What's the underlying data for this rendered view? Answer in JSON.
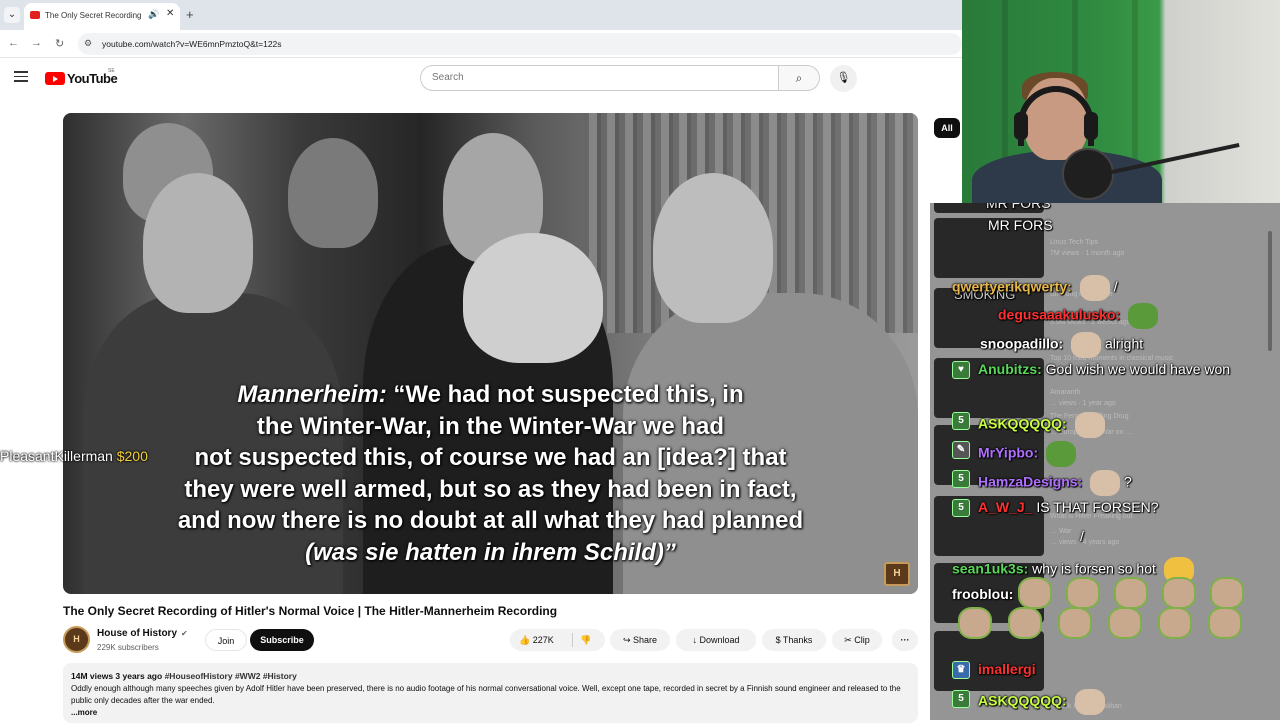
{
  "browser": {
    "tab_title": "The Only Secret Recording",
    "url": "youtube.com/watch?v=WE6mnPmztoQ&t=122s"
  },
  "youtube": {
    "logo_text": "YouTube",
    "country_code": "SE",
    "search_placeholder": "Search"
  },
  "video": {
    "subtitle_speaker": "Mannerheim:",
    "subtitle_lines": [
      "“We had not suspected this, in",
      "the Winter-War, in the Winter-War we had",
      "not suspected this, of course we had an [idea?] that",
      "they were well armed, but so as they had been in fact,",
      "and now there is no doubt at all what they had planned"
    ],
    "subtitle_german": "(was sie hatten in ihrem Schild)”",
    "watermark": "H",
    "donation_user": "PleasantKillerman",
    "donation_amount": "$200",
    "title": "The Only Secret Recording of Hitler's Normal Voice | The Hitler-Mannerheim Recording"
  },
  "channel": {
    "avatar_text": "H",
    "name": "House of History",
    "subscribers": "229K subscribers",
    "join_label": "Join",
    "subscribe_label": "Subscribe"
  },
  "actions": {
    "likes": "227K",
    "share_label": "Share",
    "download_label": "Download",
    "thanks_label": "Thanks",
    "clip_label": "Clip",
    "more_label": "···"
  },
  "description": {
    "meta": "14M views  3 years ago",
    "tags": "#HouseofHistory #WW2 #History",
    "text": "Oddly enough although many speeches given by Adolf Hitler have been preserved, there is no audio footage of his normal conversational voice. Well, except one tape, recorded in secret by a Finnish sound engineer and released to the public only decades after the war ended.",
    "more": "...more"
  },
  "sidebar": {
    "chip_all": "All",
    "thumb_texts": [
      "Linus Tech Tips",
      "7M views · 1 month ago",
      "Smoking is … home",
      "5.9M views · 2 weeks ago",
      "Top 10 mob moments in classical music",
      "Amaranth",
      "… views · 1 year ago",
      "The Fentanyl Killing Drug",
      "… Europe | The War on …",
      "What is Hitler Freaking out",
      "… War",
      "… views · 4 years ago",
      "A Look Inside a Taliban"
    ]
  },
  "chat": {
    "messages": [
      {
        "user": "",
        "text": "MR FORS",
        "color": "#ffffff"
      },
      {
        "user": "qwertyerikqwerty:",
        "text": "/",
        "color": "#e8b84a"
      },
      {
        "user": "degusaaakulusko:",
        "text": "",
        "color": "#ff3030"
      },
      {
        "user": "snoopadillo:",
        "text": "alright",
        "color": "#ffffff"
      },
      {
        "user": "Anubitzs:",
        "text": "God wish we would have won",
        "color": "#5ad85a"
      },
      {
        "user": "ASKQQQQQ:",
        "text": "",
        "color": "#c8ff40"
      },
      {
        "user": "MrYipbo:",
        "text": "",
        "color": "#b070ff"
      },
      {
        "user": "HamzaDesigns:",
        "text": "?",
        "color": "#b070ff"
      },
      {
        "user": "A_W_J_",
        "text": "IS THAT FORSEN?",
        "color": "#ff3030"
      },
      {
        "user": "",
        "text": "/",
        "color": "#ffffff"
      },
      {
        "user": "sean1uk3s:",
        "text": "why is forsen so hot",
        "color": "#5ad85a"
      },
      {
        "user": "frooblou:",
        "text": "",
        "color": "#ffffff"
      },
      {
        "user": "imallergi",
        "text": "",
        "color": "#ff3030"
      },
      {
        "user": "ASKQQQQQ:",
        "text": "",
        "color": "#c8ff40"
      }
    ],
    "ticker_text": "MR FORS",
    "smoking_text": "SMOKING"
  }
}
